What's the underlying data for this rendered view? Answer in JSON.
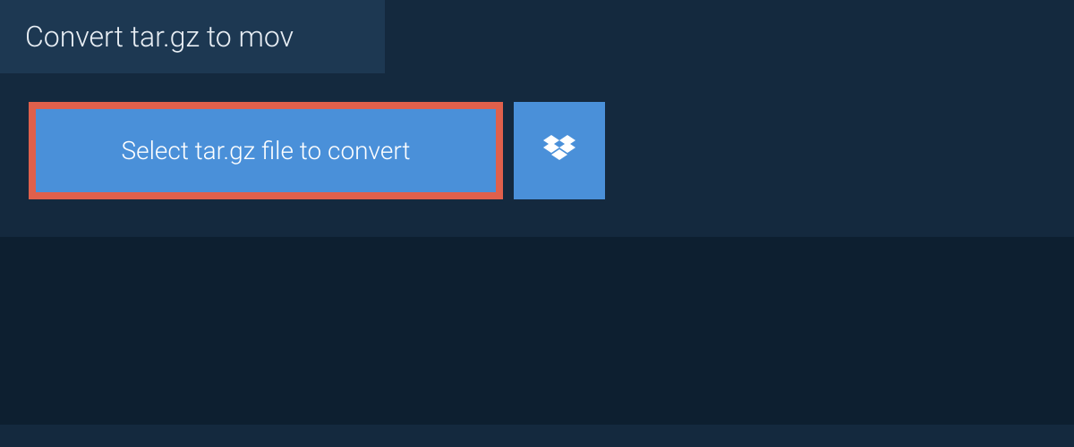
{
  "header": {
    "title": "Convert tar.gz to mov"
  },
  "actions": {
    "select_file_label": "Select tar.gz file to convert"
  },
  "colors": {
    "bg": "#14293e",
    "header_bg": "#1d3852",
    "button_bg": "#4a90d9",
    "highlight_border": "#e0604c",
    "bottom_bg": "#0d1f30"
  }
}
